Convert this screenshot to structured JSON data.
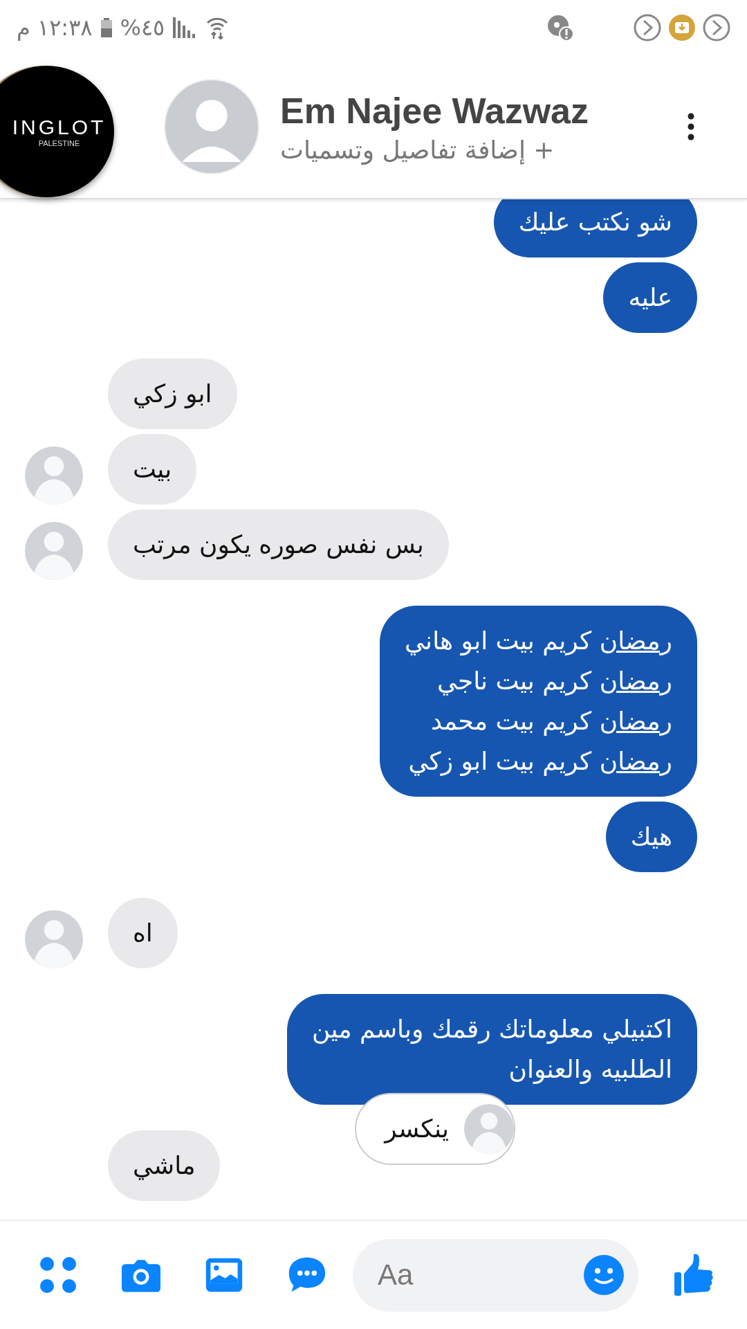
{
  "status_bar": {
    "time": "١٢:٣٨ م",
    "battery": "%٤٥"
  },
  "floating_head": {
    "title": "INGLOT",
    "subtitle": "PALESTINE"
  },
  "header": {
    "name": "Em Najee Wazwaz",
    "subtitle": "+ إضافة تفاصيل وتسميات"
  },
  "messages": [
    {
      "kind": "outgoing",
      "lines": [
        {
          "text": "شو نكتب عليك"
        }
      ]
    },
    {
      "kind": "outgoing",
      "lines": [
        {
          "text": "عليه"
        }
      ]
    },
    {
      "kind": "incoming",
      "show_avatar": false,
      "lines": [
        {
          "text": "ابو زكي"
        }
      ]
    },
    {
      "kind": "incoming",
      "show_avatar": true,
      "lines": [
        {
          "text": "بيت"
        }
      ]
    },
    {
      "kind": "incoming",
      "show_avatar": true,
      "lines": [
        {
          "text": "بس نفس صوره يكون مرتب"
        }
      ]
    },
    {
      "kind": "outgoing",
      "lines": [
        {
          "link": "رمضان",
          "text": "كريم بيت ابو هاني"
        },
        {
          "link": "رمضان",
          "text": "كريم بيت ناجي"
        },
        {
          "link": "رمضان",
          "text": "كريم بيت محمد"
        },
        {
          "link": "رمضان",
          "text": "كريم بيت ابو زكي"
        }
      ]
    },
    {
      "kind": "outgoing",
      "lines": [
        {
          "text": "هيك"
        }
      ]
    },
    {
      "kind": "incoming",
      "show_avatar": true,
      "lines": [
        {
          "text": "اه"
        }
      ]
    },
    {
      "kind": "outgoing",
      "lines": [
        {
          "text": "اكتبيلي معلوماتك رقمك وباسم مين"
        },
        {
          "text": "الطلبيه والعنوان"
        }
      ],
      "reaction": {
        "text": "ينكسر"
      }
    },
    {
      "kind": "incoming",
      "show_avatar": false,
      "lines": [
        {
          "text": "ماشي"
        }
      ]
    }
  ],
  "composer": {
    "placeholder": "Aa"
  }
}
